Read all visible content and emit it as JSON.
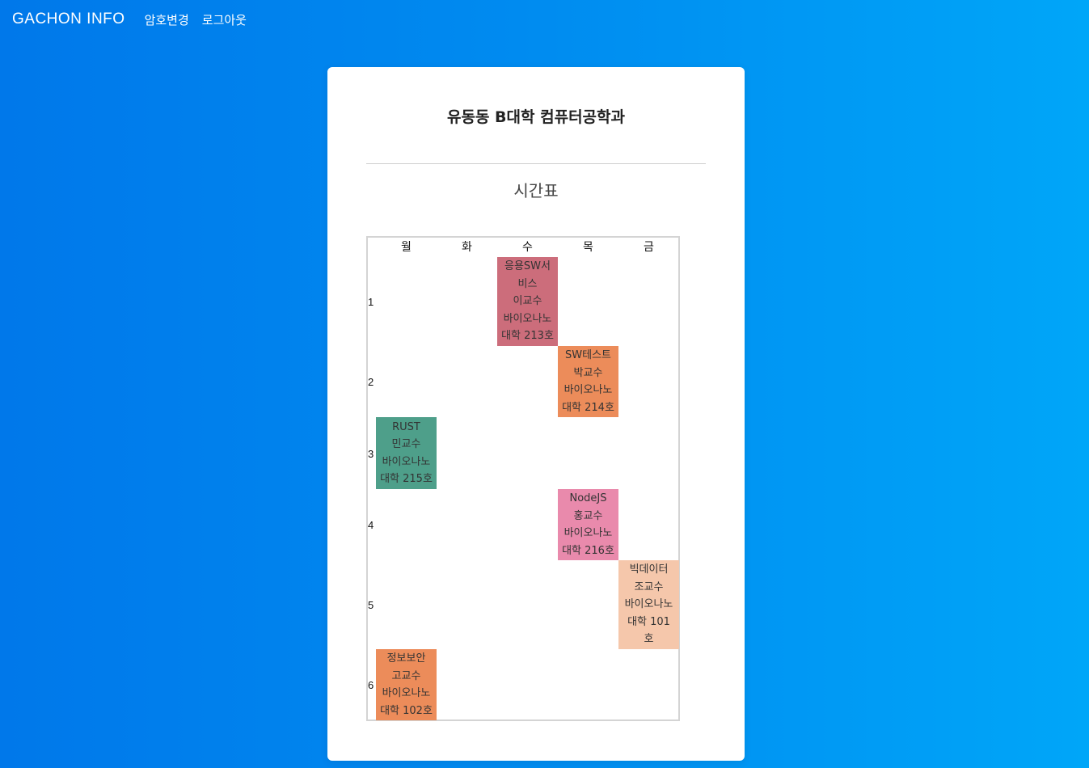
{
  "nav": {
    "brand": "GACHON INFO",
    "change_password": "암호변경",
    "logout": "로그아웃"
  },
  "card": {
    "title": "유동동 B대학 컴퓨터공학과",
    "section": "시간표"
  },
  "timetable": {
    "days": [
      "월",
      "화",
      "수",
      "목",
      "금"
    ],
    "periods": [
      "1",
      "2",
      "3",
      "4",
      "5",
      "6"
    ],
    "classes": [
      {
        "name": "응용SW서비스",
        "name_lines": [
          "응용SW서",
          "비스"
        ],
        "professor": "이교수",
        "room_lines": [
          "바이오나노",
          "대학 213호"
        ],
        "color": "#cc6d7b"
      },
      {
        "name": "SW테스트",
        "name_lines": [
          "SW테스트"
        ],
        "professor": "박교수",
        "room_lines": [
          "바이오나노",
          "대학 214호"
        ],
        "color": "#ec8c5a"
      },
      {
        "name": "RUST",
        "name_lines": [
          "RUST"
        ],
        "professor": "민교수",
        "room_lines": [
          "바이오나노",
          "대학 215호"
        ],
        "color": "#4e9f8a"
      },
      {
        "name": "NodeJS",
        "name_lines": [
          "NodeJS"
        ],
        "professor": "홍교수",
        "room_lines": [
          "바이오나노",
          "대학 216호"
        ],
        "color": "#e98aac"
      },
      {
        "name": "빅데이터",
        "name_lines": [
          "빅데이터"
        ],
        "professor": "조교수",
        "room_lines": [
          "바이오나노",
          "대학 101",
          "호"
        ],
        "color": "#f5c7ab"
      },
      {
        "name": "정보보안",
        "name_lines": [
          "정보보안"
        ],
        "professor": "고교수",
        "room_lines": [
          "바이오나노",
          "대학 102호"
        ],
        "color": "#ec8c5a"
      }
    ]
  }
}
